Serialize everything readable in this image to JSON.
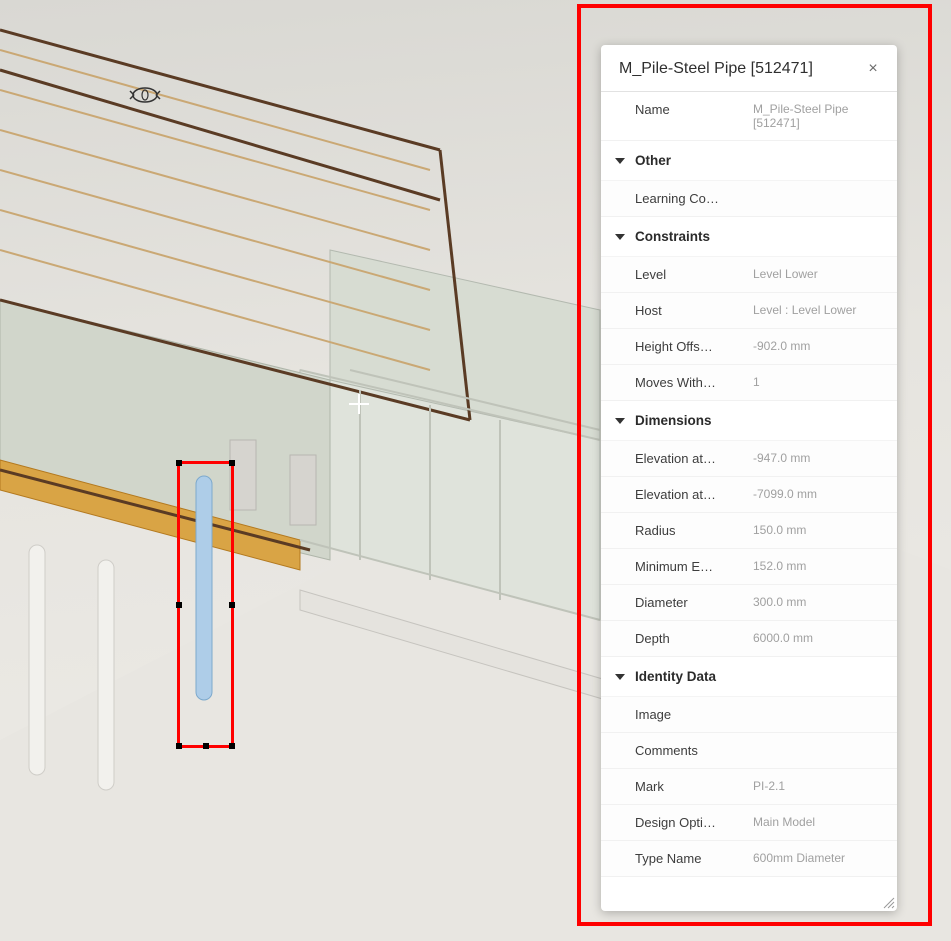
{
  "panel": {
    "title": "M_Pile-Steel Pipe [512471]",
    "close_label": "×",
    "name_row": {
      "label": "Name",
      "value": "M_Pile-Steel Pipe [512471]"
    },
    "groups": [
      {
        "title": "Other",
        "rows": [
          {
            "label": "Learning Co…",
            "value": ""
          }
        ]
      },
      {
        "title": "Constraints",
        "rows": [
          {
            "label": "Level",
            "value": "Level Lower"
          },
          {
            "label": "Host",
            "value": "Level : Level Lower"
          },
          {
            "label": "Height Offs…",
            "value": "-902.0 mm"
          },
          {
            "label": "Moves With…",
            "value": "1"
          }
        ]
      },
      {
        "title": "Dimensions",
        "rows": [
          {
            "label": "Elevation at…",
            "value": "-947.0 mm"
          },
          {
            "label": "Elevation at…",
            "value": "-7099.0 mm"
          },
          {
            "label": "Radius",
            "value": "150.0 mm"
          },
          {
            "label": "Minimum E…",
            "value": "152.0 mm"
          },
          {
            "label": "Diameter",
            "value": "300.0 mm"
          },
          {
            "label": "Depth",
            "value": "6000.0 mm"
          }
        ]
      },
      {
        "title": "Identity Data",
        "rows": [
          {
            "label": "Image",
            "value": ""
          },
          {
            "label": "Comments",
            "value": ""
          },
          {
            "label": "Mark",
            "value": "PI-2.1"
          },
          {
            "label": "Design Opti…",
            "value": "Main Model"
          },
          {
            "label": "Type Name",
            "value": "600mm Diameter"
          }
        ]
      }
    ]
  },
  "viewport": {
    "title": "3D structural model viewport",
    "selected_element": "M_Pile-Steel Pipe"
  },
  "colors": {
    "annotation": "#ff0000",
    "panel_bg": "#ffffff",
    "label": "#3d3d3d",
    "value": "#a0a0a0",
    "selected_pile": "#aecde8"
  }
}
